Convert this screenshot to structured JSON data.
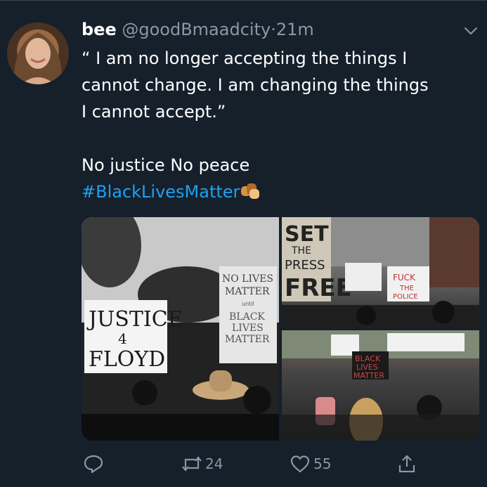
{
  "tweet": {
    "author_name": "bee",
    "author_handle": "@goodBmaadcity",
    "separator": "·",
    "time": "21m",
    "text_lines": [
      "“ I am no longer accepting the things I",
      "cannot change. I am changing the things",
      "I cannot accept.”"
    ],
    "text_line2": "No justice No peace",
    "hashtag": "#BlackLivesMatter",
    "emoji": "raised-fist-emoji"
  },
  "media": {
    "images": [
      {
        "alt": "protest-signs-justice-4-floyd",
        "signs": [
          "JUSTICE",
          "4",
          "FLOYD",
          "NO LIVES",
          "MATTER",
          "until",
          "BLACK",
          "LIVES",
          "MATTER"
        ]
      },
      {
        "alt": "protest-signs-set-the-press-free",
        "signs": [
          "SET",
          "THE",
          "PRESS",
          "FREE",
          "FUCK",
          "THE",
          "POLICE"
        ]
      },
      {
        "alt": "protest-crowd-black-lives-matter",
        "signs": [
          "BLACK",
          "LIVES",
          "MATTER"
        ]
      }
    ]
  },
  "actions": {
    "reply_icon": "reply-icon",
    "retweet_icon": "retweet-icon",
    "retweet_count": "24",
    "like_icon": "heart-icon",
    "like_count": "55",
    "share_icon": "share-icon"
  },
  "colors": {
    "background": "#15202b",
    "secondary_text": "#8899a6",
    "link": "#1da1f2",
    "divider": "#38444d"
  }
}
